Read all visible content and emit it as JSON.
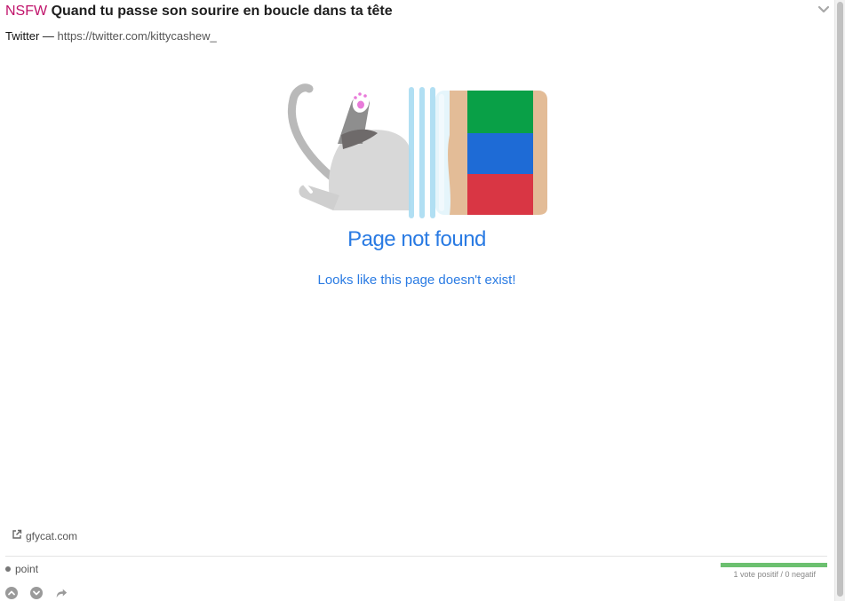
{
  "post": {
    "nsfw_tag": "NSFW",
    "title": "Quand tu passe son sourire en boucle dans ta tête",
    "source_name": "Twitter",
    "source_separator": "—",
    "source_url": "https://twitter.com/kittycashew_"
  },
  "embed": {
    "error_title": "Page not found",
    "error_message": "Looks like this page doesn't exist!",
    "jar_colors": [
      "#09a047",
      "#1e6bd6",
      "#d93644"
    ]
  },
  "footer": {
    "domain": "gfycat.com",
    "points_label": "point",
    "vote_summary": "1 vote positif / 0 negatif",
    "positive_ratio": 1.0
  },
  "icons": {
    "collapse": "chevron-down-icon",
    "external": "external-link-icon",
    "upvote": "upvote-icon",
    "downvote": "downvote-icon",
    "share": "share-icon"
  }
}
